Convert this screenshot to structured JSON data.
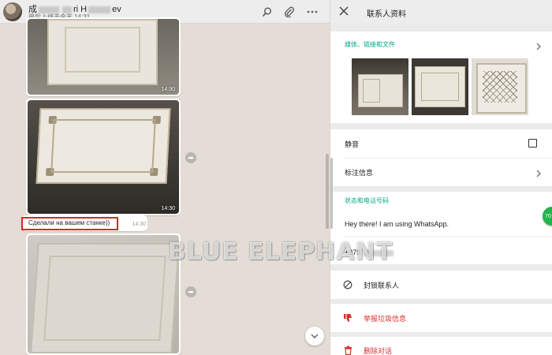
{
  "chat": {
    "contact_name_prefix": "成",
    "contact_name_mid": "ri H",
    "contact_name_suffix": "ev",
    "last_seen": "最后上线于今天 14:31",
    "messages": [
      {
        "type": "image",
        "time": "14:30"
      },
      {
        "type": "image",
        "time": "14:30"
      },
      {
        "type": "text",
        "text": "Сделали на вашем станке))",
        "time": "14:30"
      },
      {
        "type": "image",
        "time": ""
      }
    ]
  },
  "info": {
    "title": "联系人资料",
    "media_label": "媒体、链接和文件",
    "mute_label": "静音",
    "starred_label": "标注信息",
    "status_section_label": "状态和电话号码",
    "status_text": "Hey there! I am using WhatsApp.",
    "phone_prefix": "+375",
    "block_label": "封锁联系人",
    "report_label": "举报垃圾信息",
    "delete_label": "删除对话"
  },
  "badge": {
    "text": "70"
  },
  "watermark": {
    "text": "BLUE ELEPHANT"
  },
  "colors": {
    "accent": "#00a884",
    "danger": "#d9302f",
    "highlight_border": "#d62828"
  }
}
